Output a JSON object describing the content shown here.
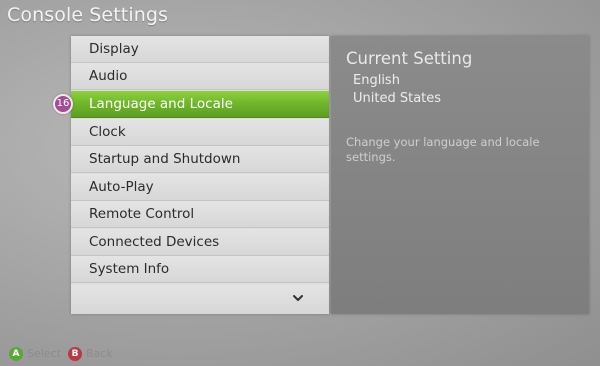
{
  "header": {
    "title": "Console Settings"
  },
  "menu": {
    "items": [
      {
        "label": "Display"
      },
      {
        "label": "Audio"
      },
      {
        "label": "Language and Locale"
      },
      {
        "label": "Clock"
      },
      {
        "label": "Startup and Shutdown"
      },
      {
        "label": "Auto-Play"
      },
      {
        "label": "Remote Control"
      },
      {
        "label": "Connected Devices"
      },
      {
        "label": "System Info"
      }
    ],
    "selected_index": 2,
    "badge": "16",
    "scroll_icon": "chevron-down-icon"
  },
  "panel": {
    "heading": "Current Setting",
    "language": "English",
    "region": "United States",
    "description": "Change your language and locale settings."
  },
  "hints": {
    "a_key": "A",
    "a_label": "Select",
    "b_key": "B",
    "b_label": "Back"
  },
  "colors": {
    "selected": "#6fb52a",
    "badge": "#a24e96",
    "button_a": "#5aa838",
    "button_b": "#b73a45"
  }
}
